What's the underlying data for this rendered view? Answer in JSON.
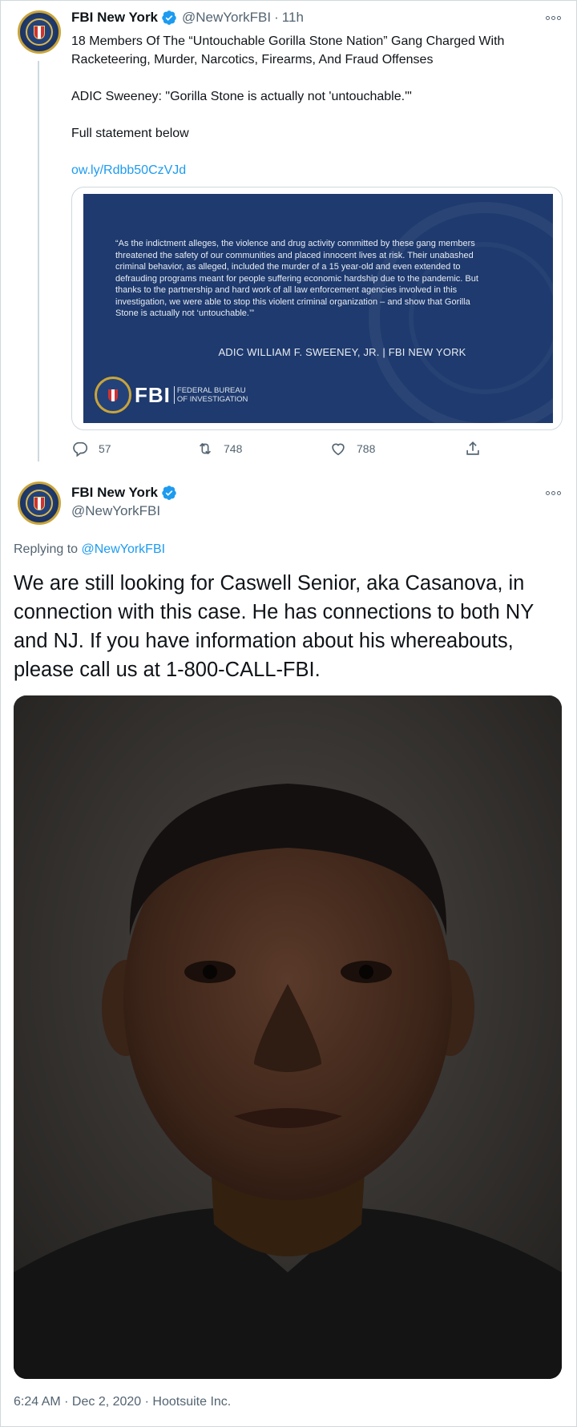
{
  "tweet1": {
    "author_name": "FBI New York",
    "author_handle": "@NewYorkFBI",
    "time_ago": "11h",
    "line1": "18 Members Of The “Untouchable Gorilla Stone Nation” Gang Charged With",
    "line2": "Racketeering, Murder, Narcotics, Firearms, And Fraud Offenses",
    "line3": "ADIC Sweeney: \"Gorilla Stone is actually not 'untouchable.'\"",
    "line4": "Full statement below",
    "link": "ow.ly/Rdbb50CzVJd",
    "card": {
      "quote": "“As the indictment alleges, the violence and drug activity committed by these gang members threatened the safety of our communities and placed innocent lives at risk.  Their unabashed criminal behavior, as alleged, included the murder of a 15 year-old and even extended to defrauding programs meant for people suffering economic hardship due to the pandemic.  But thanks to the partnership and hard work of all law enforcement agencies involved in this investigation, we were able to stop this violent criminal organization – and show that Gorilla Stone is actually not ‘untouchable.’”",
      "signature": "ADIC WILLIAM F. SWEENEY, JR.  |  FBI NEW YORK",
      "logo_letters": "FBI",
      "logo_line1": "FEDERAL BUREAU",
      "logo_line2": "OF INVESTIGATION"
    },
    "replies": "57",
    "retweets": "748",
    "likes": "788"
  },
  "tweet2": {
    "author_name": "FBI New York",
    "author_handle": "@NewYorkFBI",
    "replying_prefix": "Replying to ",
    "replying_to": "@NewYorkFBI",
    "text": "We are still looking for Caswell Senior, aka Casanova, in connection with this case.  He has connections to both NY and NJ.  If you have information about his whereabouts, please call us at 1-800-CALL-FBI.",
    "timestamp": "6:24 AM · Dec 2, 2020 · Hootsuite Inc."
  },
  "icons": {
    "verified": "verified-badge-icon",
    "more": "more-options-icon",
    "reply": "reply-icon",
    "retweet": "retweet-icon",
    "like": "like-icon",
    "share": "share-icon"
  },
  "colors": {
    "link": "#1d9bf0",
    "secondary_text": "#536471",
    "card_background": "#1e3a6e"
  }
}
